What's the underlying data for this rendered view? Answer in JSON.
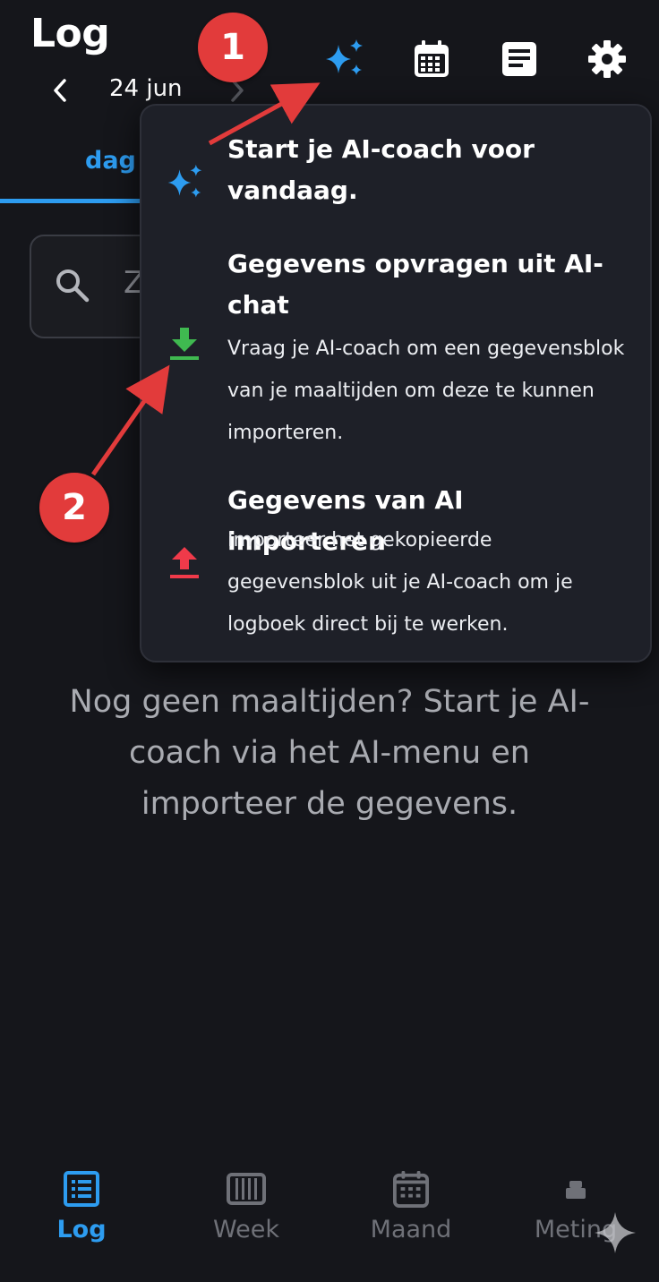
{
  "header": {
    "title": "Log",
    "date": "24 jun"
  },
  "tabs": [
    {
      "label": "dag",
      "active": true
    }
  ],
  "search": {
    "placeholder_visible": "Z"
  },
  "menu": {
    "items": [
      {
        "icon": "sparkles-icon",
        "title": "Start je AI-coach voor vandaag.",
        "description": ""
      },
      {
        "icon": "download-icon",
        "title": "Gegevens opvragen uit AI-chat",
        "description": "Vraag je AI-coach om een gegevensblok van je maaltijden om deze te kunnen importeren."
      },
      {
        "icon": "upload-icon",
        "title": "Gegevens van AI importeren",
        "description": "Importeer het gekopieerde gegevensblok uit je AI-coach om je logboek direct bij te werken."
      }
    ]
  },
  "empty_state": "Nog geen maaltijden? Start je AI-coach via het AI-menu en importeer de gegevens.",
  "callouts": [
    "1",
    "2"
  ],
  "bottom_nav": [
    {
      "label": "Log",
      "icon": "list-icon",
      "active": true
    },
    {
      "label": "Week",
      "icon": "week-columns-icon",
      "active": false
    },
    {
      "label": "Maand",
      "icon": "calendar-icon",
      "active": false
    },
    {
      "label": "Meting",
      "icon": "scale-icon",
      "active": false
    }
  ],
  "colors": {
    "background": "#15161b",
    "accent": "#2d9cf0",
    "menu_bg": "#1e2028",
    "callout": "#e23b3b",
    "download_green": "#3fb950",
    "upload_red": "#f03a4a"
  }
}
